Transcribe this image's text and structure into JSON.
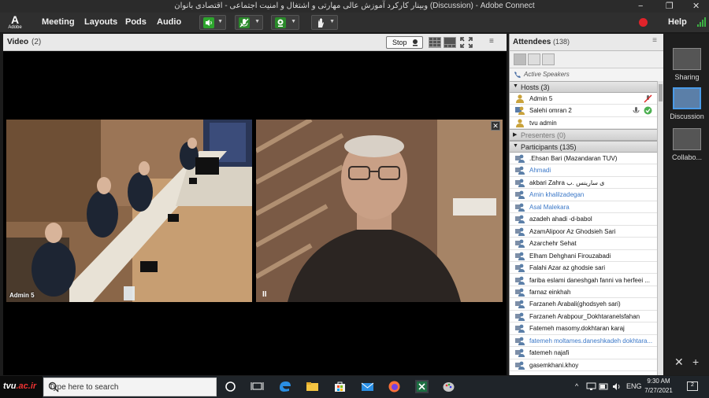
{
  "window": {
    "title": "وبینار کارکرد آموزش عالی مهارتی و اشتغال و امنیت اجتماعی - اقتصادی بانوان (Discussion) - Adobe Connect",
    "minimize": "−",
    "maximize": "❐",
    "close": "✕"
  },
  "menubar": {
    "logo": "A",
    "logo_text": "Adobe",
    "items": [
      "Meeting",
      "Layouts",
      "Pods",
      "Audio"
    ],
    "help": "Help"
  },
  "video_pod": {
    "title": "Video",
    "count": "(2)",
    "stop_label": "Stop",
    "menu": "≡",
    "feeds": [
      {
        "label": "Admin 5"
      },
      {
        "label": "",
        "pause": "II",
        "close": "✕"
      }
    ]
  },
  "attendees_pod": {
    "title": "Attendees",
    "count": "(138)",
    "menu": "≡",
    "active_speakers": "Active Speakers",
    "hosts": {
      "label": "Hosts (3)",
      "members": [
        "Admin 5",
        "Salehi omran 2",
        "tvu admin"
      ]
    },
    "presenters": {
      "label": "Presenters (0)"
    },
    "participants": {
      "label": "Participants (135)",
      "members": [
        {
          "name": ".Ehsan Bari (Mazandaran TUV)",
          "blue": false
        },
        {
          "name": "Ahmadi",
          "blue": true
        },
        {
          "name": "akbari Zahra ی سارینس .ب",
          "blue": false
        },
        {
          "name": "Amin khalilzadegan",
          "blue": true
        },
        {
          "name": "Asal Malekara",
          "blue": true
        },
        {
          "name": "azadeh ahadi -d-babol",
          "blue": false
        },
        {
          "name": "AzamAlipoor Az Ghodsieh Sari",
          "blue": false
        },
        {
          "name": "Azarchehr Sehat",
          "blue": false
        },
        {
          "name": "Elham Dehghani Firouzabadi",
          "blue": false
        },
        {
          "name": "Falahi Azar az ghodsie sari",
          "blue": false
        },
        {
          "name": "fariba eslami daneshgah fanni va herfeei ...",
          "blue": false
        },
        {
          "name": "farnaz einkhah",
          "blue": false
        },
        {
          "name": "Farzaneh Arabali(ghodsyeh sari)",
          "blue": false
        },
        {
          "name": "Farzaneh Arabpour_Dokhtaranelsfahan",
          "blue": false
        },
        {
          "name": "Fatemeh masomy.dokhtaran karaj",
          "blue": false
        },
        {
          "name": "fatemeh moltames.daneshkadeh dokhtara...",
          "blue": true
        },
        {
          "name": "fatemeh najafi",
          "blue": false
        },
        {
          "name": "gasemkhani.khoy",
          "blue": false
        }
      ]
    }
  },
  "layouts": [
    {
      "label": "Sharing"
    },
    {
      "label": "Discussion"
    },
    {
      "label": "Collabo..."
    }
  ],
  "layout_tools": {
    "tools": "✕",
    "add": "+"
  },
  "taskbar": {
    "brand_prefix": "tvu",
    "brand_suffix": ".ac.ir",
    "search_placeholder": "Type here to search",
    "tray_up": "^",
    "language": "ENG",
    "time": "9:30 AM",
    "date": "7/27/2021",
    "notifications": "2"
  },
  "colors": {
    "accent": "#4a9be8",
    "record": "#e0232a",
    "participant_blue": "#3b78c8"
  }
}
